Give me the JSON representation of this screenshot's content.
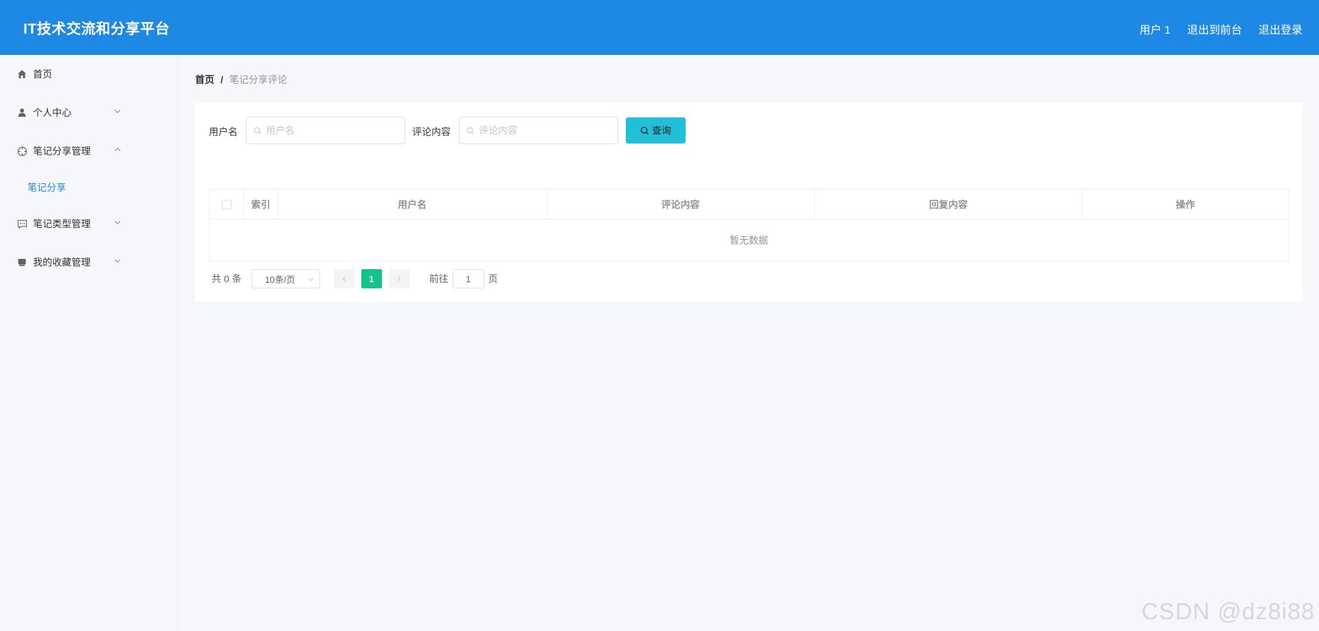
{
  "header": {
    "title": "IT技术交流和分享平台",
    "user": "用户 1",
    "back_to_front": "退出到前台",
    "logout": "退出登录"
  },
  "sidebar": {
    "items": [
      {
        "label": "首页",
        "icon": "home-icon"
      },
      {
        "label": "个人中心",
        "icon": "user-icon",
        "expanded": false
      },
      {
        "label": "笔记分享管理",
        "icon": "crosshair-icon",
        "expanded": true,
        "children": [
          {
            "label": "笔记分享"
          }
        ]
      },
      {
        "label": "笔记类型管理",
        "icon": "chat-icon",
        "expanded": false
      },
      {
        "label": "我的收藏管理",
        "icon": "folder-icon",
        "expanded": false
      }
    ]
  },
  "breadcrumb": {
    "home": "首页",
    "separator": "/",
    "current": "笔记分享评论"
  },
  "search": {
    "username_label": "用户名",
    "username_placeholder": "用户名",
    "comment_label": "评论内容",
    "comment_placeholder": "评论内容",
    "query_button": "查询"
  },
  "table": {
    "columns": [
      "索引",
      "用户名",
      "评论内容",
      "回复内容",
      "操作"
    ],
    "rows": [],
    "empty_text": "暂无数据"
  },
  "pagination": {
    "total_text": "共 0 条",
    "page_size": "10条/页",
    "current_page": "1",
    "goto_label": "前往",
    "goto_value": "1",
    "page_suffix": "页"
  },
  "watermark": "CSDN @dz8i88",
  "colors": {
    "header": "#1e88e5",
    "query_button": "#22c0d8",
    "active_page": "#13c38b",
    "active_submenu": "#1e88e5"
  }
}
